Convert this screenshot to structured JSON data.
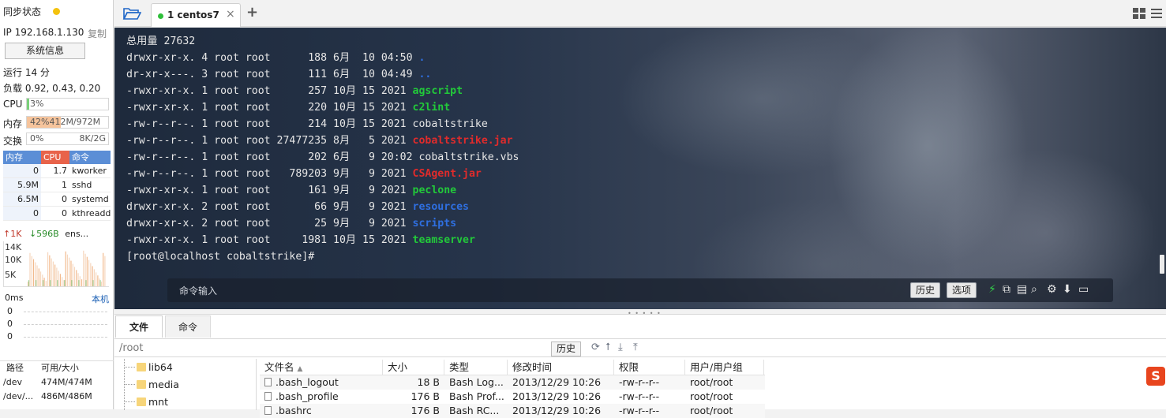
{
  "left_panel": {
    "sync_label": "同步状态",
    "ip": "IP 192.168.1.130",
    "copy": "复制",
    "sysinfo": "系统信息",
    "uptime": "运行 14 分",
    "load": "负载 0.92, 0.43, 0.20",
    "cpu": {
      "label": "CPU",
      "text": "3%",
      "fraction": 0.03
    },
    "mem": {
      "label": "内存",
      "text": "42%412M/972M",
      "fraction": 0.42
    },
    "swap": {
      "label": "交换",
      "text": "0%",
      "right": "8K/2G",
      "fraction": 0.0
    },
    "proc_head": {
      "mem": "内存",
      "cpu": "CPU",
      "cmd": "命令"
    },
    "processes": [
      {
        "mem": "0",
        "cpu": "1.7",
        "cmd": "kworker"
      },
      {
        "mem": "5.9M",
        "cpu": "1",
        "cmd": "sshd"
      },
      {
        "mem": "6.5M",
        "cpu": "0",
        "cmd": "systemd"
      },
      {
        "mem": "0",
        "cpu": "0",
        "cmd": "kthreadd"
      }
    ],
    "net": {
      "up": "↑1K",
      "down": "↓596B",
      "iface": "ens..."
    },
    "net_scale": [
      "14K",
      "10K",
      "5K"
    ],
    "ping": {
      "label": "0ms",
      "local": "本机",
      "values": [
        "0",
        "0",
        "0"
      ]
    },
    "disk_head": {
      "path": "路径",
      "avail": "可用/大小"
    },
    "disks": [
      {
        "path": "/dev",
        "avail": "474M/474M"
      },
      {
        "path": "/dev/...",
        "avail": "486M/486M"
      }
    ]
  },
  "tabs": {
    "active": "1  centos7",
    "close": "×",
    "add": "+"
  },
  "terminal": {
    "lines": [
      {
        "pre": "总用量 27632",
        "name": "",
        "cls": "f-plain"
      },
      {
        "pre": "drwxr-xr-x. 4 root root      188 6月  10 04:50 ",
        "name": ".",
        "cls": "f-dir"
      },
      {
        "pre": "dr-xr-x---. 3 root root      111 6月  10 04:49 ",
        "name": "..",
        "cls": "f-dir"
      },
      {
        "pre": "-rwxr-xr-x. 1 root root      257 10月 15 2021 ",
        "name": "agscript",
        "cls": "f-exe"
      },
      {
        "pre": "-rwxr-xr-x. 1 root root      220 10月 15 2021 ",
        "name": "c2lint",
        "cls": "f-exe"
      },
      {
        "pre": "-rw-r--r--. 1 root root      214 10月 15 2021 ",
        "name": "cobaltstrike",
        "cls": "f-plain"
      },
      {
        "pre": "-rw-r--r--. 1 root root 27477235 8月   5 2021 ",
        "name": "cobaltstrike.jar",
        "cls": "f-red"
      },
      {
        "pre": "-rw-r--r--. 1 root root      202 6月   9 20:02 ",
        "name": "cobaltstrike.vbs",
        "cls": "f-plain"
      },
      {
        "pre": "-rw-r--r--. 1 root root   789203 9月   9 2021 ",
        "name": "CSAgent.jar",
        "cls": "f-red"
      },
      {
        "pre": "-rwxr-xr-x. 1 root root      161 9月   9 2021 ",
        "name": "peclone",
        "cls": "f-exe"
      },
      {
        "pre": "drwxr-xr-x. 2 root root       66 9月   9 2021 ",
        "name": "resources",
        "cls": "f-dir"
      },
      {
        "pre": "drwxr-xr-x. 2 root root       25 9月   9 2021 ",
        "name": "scripts",
        "cls": "f-dir"
      },
      {
        "pre": "-rwxr-xr-x. 1 root root     1981 10月 15 2021 ",
        "name": "teamserver",
        "cls": "f-exe"
      },
      {
        "pre": "[root@localhost cobaltstrike]#",
        "name": "",
        "cls": "f-plain"
      }
    ],
    "cmd_placeholder": "命令输入",
    "history_btn": "历史",
    "options_btn": "选项"
  },
  "bottom": {
    "tab_files": "文件",
    "tab_cmd": "命令",
    "path": "/root",
    "history_btn": "历史",
    "tree": [
      "lib64",
      "media",
      "mnt"
    ],
    "columns": {
      "name": "文件名",
      "size": "大小",
      "type": "类型",
      "mtime": "修改时间",
      "perm": "权限",
      "owner": "用户/用户组"
    },
    "files": [
      {
        "name": ".bash_logout",
        "size": "18 B",
        "type": "Bash Log...",
        "mtime": "2013/12/29 10:26",
        "perm": "-rw-r--r--",
        "owner": "root/root"
      },
      {
        "name": ".bash_profile",
        "size": "176 B",
        "type": "Bash Prof...",
        "mtime": "2013/12/29 10:26",
        "perm": "-rw-r--r--",
        "owner": "root/root"
      },
      {
        "name": ".bashrc",
        "size": "176 B",
        "type": "Bash RC...",
        "mtime": "2013/12/29 10:26",
        "perm": "-rw-r--r--",
        "owner": "root/root"
      }
    ]
  },
  "colors": {
    "accent_green": "#2fbf3a",
    "dir_blue": "#2f6fe0",
    "exe_green": "#22c93a",
    "archive_red": "#e02b2b",
    "sync_yellow": "#f4c20d"
  }
}
